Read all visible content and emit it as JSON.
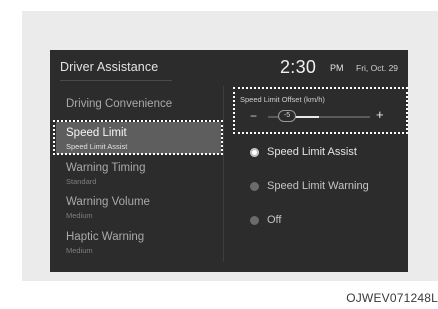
{
  "header": {
    "title": "Driver Assistance",
    "time": "2:30",
    "ampm": "PM",
    "date": "Fri, Oct. 29"
  },
  "sidebar": {
    "items": [
      {
        "label": "Driving Convenience",
        "sub": ""
      },
      {
        "label": "Speed Limit",
        "sub": "Speed Limit Assist",
        "selected": true
      },
      {
        "label": "Warning Timing",
        "sub": "Standard"
      },
      {
        "label": "Warning Volume",
        "sub": "Medium"
      },
      {
        "label": "Haptic Warning",
        "sub": "Medium"
      }
    ]
  },
  "offset": {
    "label": "Speed Limit Offset (km/h)",
    "value": "-5",
    "minus": "−",
    "plus": "+",
    "level_fraction": 0.25
  },
  "options": [
    {
      "label": "Speed Limit Assist",
      "checked": true
    },
    {
      "label": "Speed Limit Warning",
      "checked": false
    },
    {
      "label": "Off",
      "checked": false
    }
  ],
  "caption": "OJWEV071248L",
  "colors": {
    "screen_background": "#2c2c2c",
    "selected_row": "#5e5e5e",
    "frame_background": "#ebebeb",
    "highlight": "#ffffff"
  }
}
